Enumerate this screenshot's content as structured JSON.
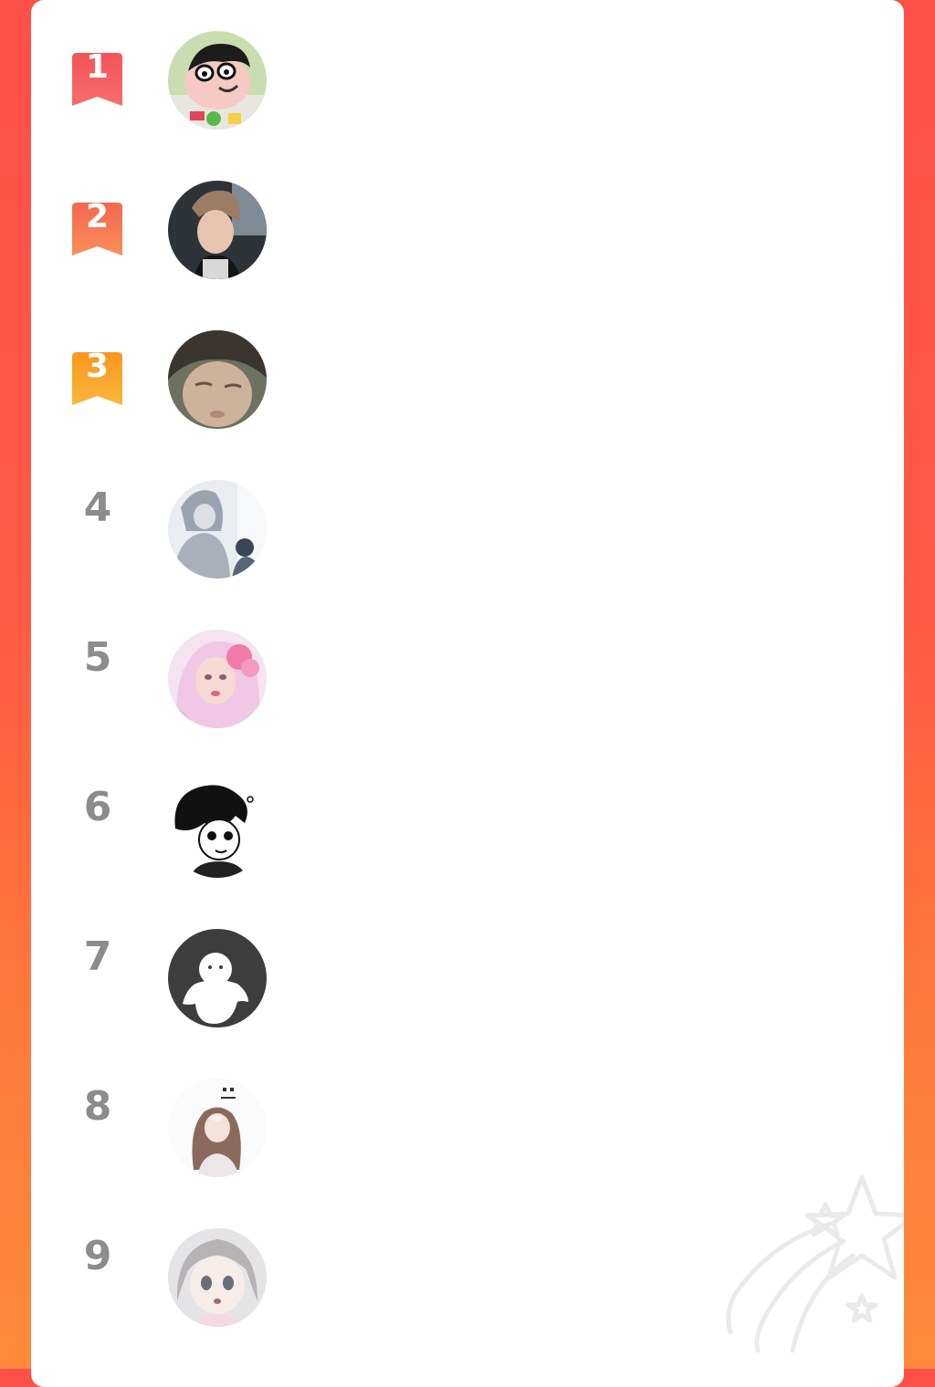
{
  "ranking": {
    "items": [
      {
        "rank": "1",
        "badge": true,
        "badge_color": "#f5565a",
        "avatar": "crayon-cartoon-avatar"
      },
      {
        "rank": "2",
        "badge": true,
        "badge_color": "#f77a4f",
        "avatar": "young-man-photo-avatar"
      },
      {
        "rank": "3",
        "badge": true,
        "badge_color": "#f9a326",
        "avatar": "sleeping-boy-photo-avatar"
      },
      {
        "rank": "4",
        "badge": false,
        "avatar": "anime-couple-avatar"
      },
      {
        "rank": "5",
        "badge": false,
        "avatar": "pink-hair-girl-avatar"
      },
      {
        "rank": "6",
        "badge": false,
        "avatar": "manga-boy-avatar"
      },
      {
        "rank": "7",
        "badge": false,
        "avatar": "default-ghost-avatar"
      },
      {
        "rank": "8",
        "badge": false,
        "avatar": "illustrated-girl-avatar"
      },
      {
        "rank": "9",
        "badge": false,
        "avatar": "anime-girl-avatar"
      }
    ]
  },
  "theme": {
    "background_top": "#ff4f49",
    "background_bottom": "#ff8b3a",
    "rank_text_color": "#8c8c8c",
    "card_color": "#ffffff"
  },
  "decoration": {
    "icon": "shooting-star-icon"
  }
}
